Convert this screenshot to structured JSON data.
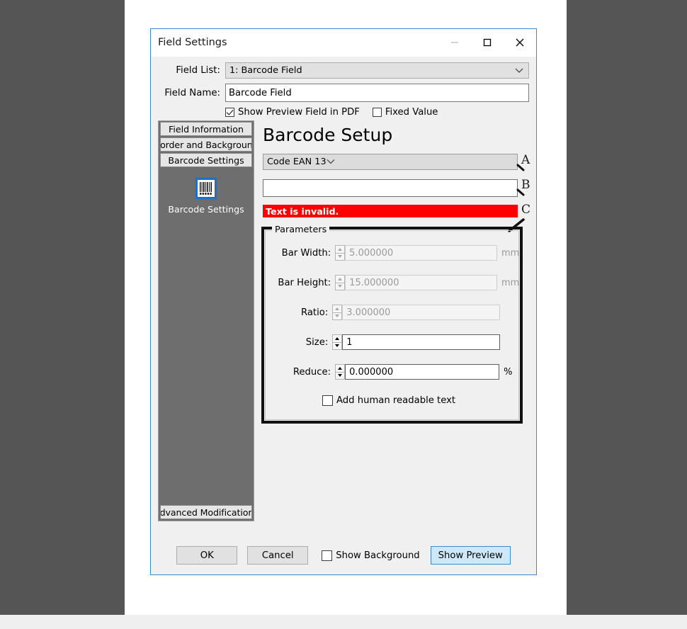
{
  "window": {
    "title": "Field Settings",
    "controls": {
      "minimize": "minimize-icon",
      "maximize": "maximize-icon",
      "close": "close-icon"
    }
  },
  "form": {
    "field_list_label": "Field List:",
    "field_list_value": "1: Barcode Field",
    "field_name_label": "Field Name:",
    "field_name_value": "Barcode Field",
    "show_preview_checkbox": {
      "label": "Show Preview Field in PDF",
      "checked": true
    },
    "fixed_value_checkbox": {
      "label": "Fixed Value",
      "checked": false
    }
  },
  "sidebar": {
    "tabs": [
      {
        "label": "Field Information",
        "active": false
      },
      {
        "label": "Border and Background",
        "active": false
      },
      {
        "label": "Barcode Settings",
        "active": true
      }
    ],
    "bottom_tab": {
      "label": "Advanced Modifications"
    },
    "icon": {
      "name": "barcode-icon",
      "caption": "Barcode Settings"
    }
  },
  "main": {
    "title": "Barcode Setup",
    "barcode_type": "Code EAN 13",
    "barcode_value": "",
    "barcode_value_placeholder": "",
    "error_message": "Text is invalid.",
    "callouts": [
      {
        "letter": "A",
        "target": "barcode-type-combo"
      },
      {
        "letter": "B",
        "target": "barcode-value-input"
      },
      {
        "letter": "C",
        "target": "error-message"
      }
    ]
  },
  "parameters": {
    "legend": "Parameters",
    "rows": [
      {
        "label": "Bar Width:",
        "value": "5.000000",
        "unit": "mm",
        "enabled": false
      },
      {
        "label": "Bar Height:",
        "value": "15.000000",
        "unit": "mm",
        "enabled": false
      },
      {
        "label": "Ratio:",
        "value": "3.000000",
        "unit": "",
        "enabled": false
      },
      {
        "label": "Size:",
        "value": "1",
        "unit": "",
        "enabled": true
      },
      {
        "label": "Reduce:",
        "value": "0.000000",
        "unit": "%",
        "enabled": true
      }
    ],
    "human_readable_checkbox": {
      "label": "Add human readable text",
      "checked": false
    }
  },
  "footer": {
    "ok_label": "OK",
    "cancel_label": "Cancel",
    "show_background_checkbox": {
      "label": "Show Background",
      "checked": false
    },
    "show_preview_label": "Show Preview"
  },
  "colors": {
    "accent": "#3b8bd4",
    "error": "#ff0000",
    "sidebar": "#6e6e6e",
    "dialog": "#f0f0f0",
    "backdrop": "#555555",
    "icon_border": "#1f6fc4"
  }
}
